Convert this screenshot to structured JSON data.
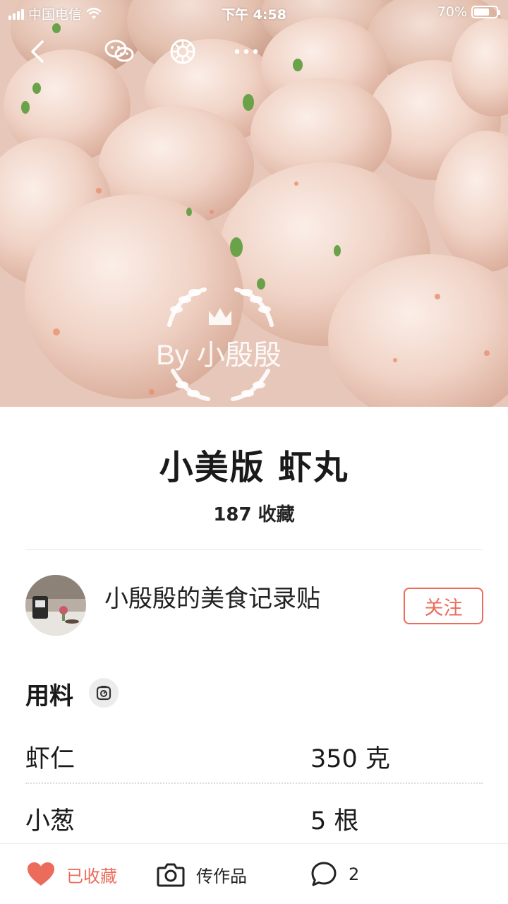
{
  "status_bar": {
    "carrier": "中国电信",
    "time": "下午 4:58",
    "battery": "70%",
    "battery_level": 0.7
  },
  "topbar": {
    "icons": [
      "back-icon",
      "wechat-icon",
      "moments-icon",
      "more-icon"
    ]
  },
  "hero": {
    "watermark": "By 小殷殷"
  },
  "recipe": {
    "title": "小美版 虾丸",
    "favorites": "187 收藏"
  },
  "author": {
    "name": "小殷殷的美食记录贴",
    "follow_label": "关注"
  },
  "ingredients": {
    "title": "用料",
    "icon": "scale-icon",
    "items": [
      {
        "name": "虾仁",
        "qty": "350 克"
      },
      {
        "name": "小葱",
        "qty": "5 根"
      }
    ]
  },
  "bottom_bar": {
    "favorite_label": "已收藏",
    "upload_label": "传作品",
    "comment_count": "2"
  },
  "colors": {
    "accent": "#ec6c5b"
  }
}
